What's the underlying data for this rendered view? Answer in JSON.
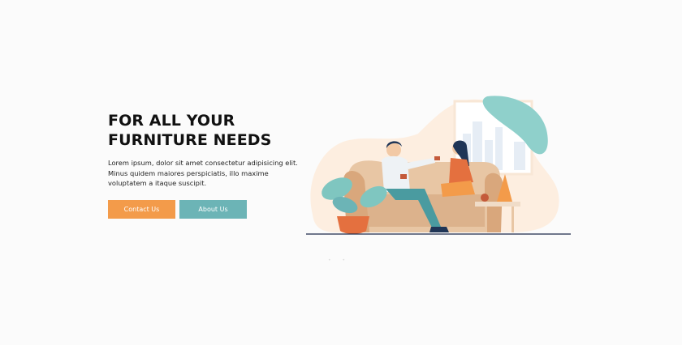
{
  "hero": {
    "title_line1": "FOR ALL YOUR",
    "title_line2": "FURNITURE NEEDS",
    "desc_line1": "Lorem ipsum, dolor sit amet consectetur adipisicing elit.",
    "desc_line2": "Minus quidem maiores perspiciatis, illo maxime",
    "desc_line3": "voluptatem a itaque suscipit."
  },
  "buttons": {
    "contact_label": "Contact Us",
    "about_label": "About Us"
  },
  "colors": {
    "accent_orange": "#f39b4a",
    "accent_teal": "#6cb4b6",
    "background": "#fbfbfb"
  },
  "icons": {
    "illustration": "couple-on-sofa-illustration"
  }
}
